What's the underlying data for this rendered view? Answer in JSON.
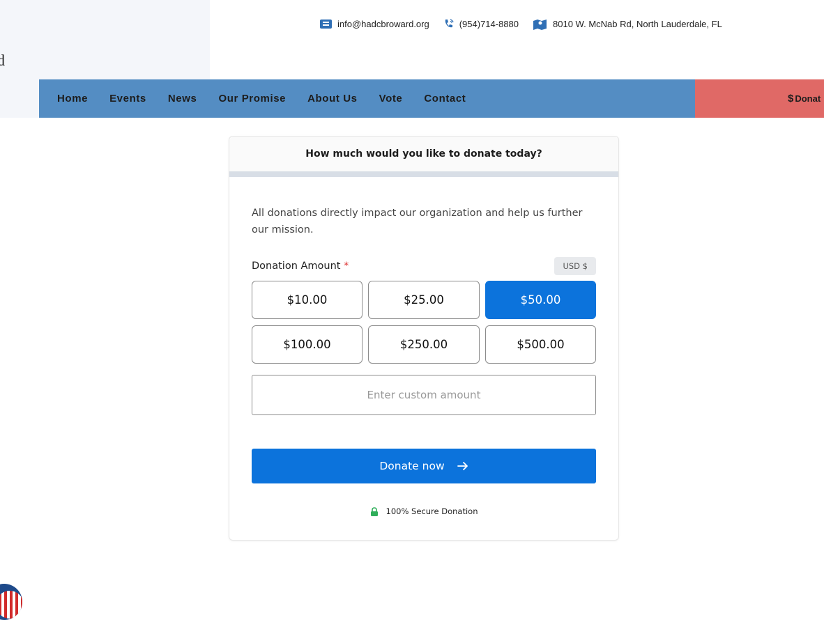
{
  "header": {
    "partial_text": "d",
    "contact": {
      "email": "info@hadcbroward.org",
      "phone": "(954)714-8880",
      "address": "8010 W. McNab Rd, North Lauderdale, FL"
    }
  },
  "nav": {
    "items": [
      {
        "label": "Home"
      },
      {
        "label": "Events"
      },
      {
        "label": "News"
      },
      {
        "label": "Our Promise"
      },
      {
        "label": "About Us"
      },
      {
        "label": "Vote"
      },
      {
        "label": "Contact"
      }
    ],
    "donate_symbol": "$",
    "donate_label": "Donat"
  },
  "donation_form": {
    "title": "How much would you like to donate today?",
    "description": "All donations directly impact our organization and help us further our mission.",
    "amount_label": "Donation Amount",
    "required_mark": "*",
    "currency": "USD  $",
    "amounts": [
      {
        "label": "$10.00",
        "selected": false
      },
      {
        "label": "$25.00",
        "selected": false
      },
      {
        "label": "$50.00",
        "selected": true
      },
      {
        "label": "$100.00",
        "selected": false
      },
      {
        "label": "$250.00",
        "selected": false
      },
      {
        "label": "$500.00",
        "selected": false
      }
    ],
    "custom_placeholder": "Enter custom amount",
    "custom_value": "",
    "submit_label": "Donate now",
    "secure_text": "100% Secure Donation"
  },
  "colors": {
    "nav_bg": "#548dc3",
    "donate_tab_bg": "#e06966",
    "primary": "#0c73dc",
    "lock": "#2fae5a"
  },
  "icons": {
    "email": "email-icon",
    "phone": "phone-icon",
    "address": "map-icon",
    "submit_arrow": "arrow-right-icon",
    "secure": "lock-icon"
  }
}
